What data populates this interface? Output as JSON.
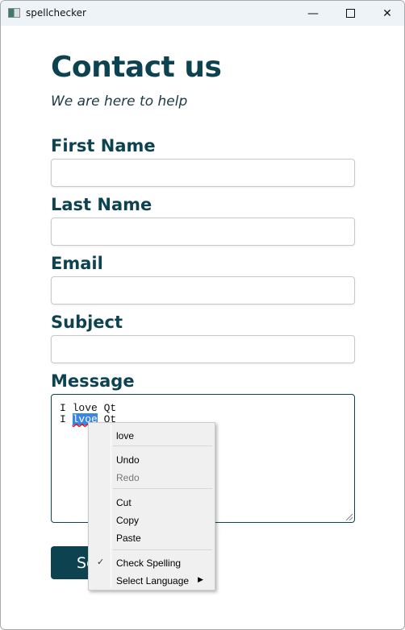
{
  "window": {
    "title": "spellchecker",
    "icons": [
      "minimize-icon",
      "maximize-icon",
      "close-icon"
    ]
  },
  "form": {
    "heading": "Contact us",
    "subtitle": "We are here to help",
    "fields": [
      {
        "label": "First Name",
        "value": ""
      },
      {
        "label": "Last Name",
        "value": ""
      },
      {
        "label": "Email",
        "value": ""
      },
      {
        "label": "Subject",
        "value": ""
      }
    ],
    "message": {
      "label": "Message",
      "line1": "I love Qt",
      "line2_prefix": "I ",
      "line2_selected": "lvoe",
      "line2_suffix": " Qt"
    },
    "submit_label": "Send"
  },
  "context_menu": {
    "suggestion": "love",
    "undo": "Undo",
    "redo": "Redo",
    "cut": "Cut",
    "copy": "Copy",
    "paste": "Paste",
    "check_spelling": "Check Spelling",
    "check_spelling_checked": true,
    "select_language": "Select Language"
  },
  "colors": {
    "accent": "#0d4350",
    "selection": "#3a86e0"
  }
}
